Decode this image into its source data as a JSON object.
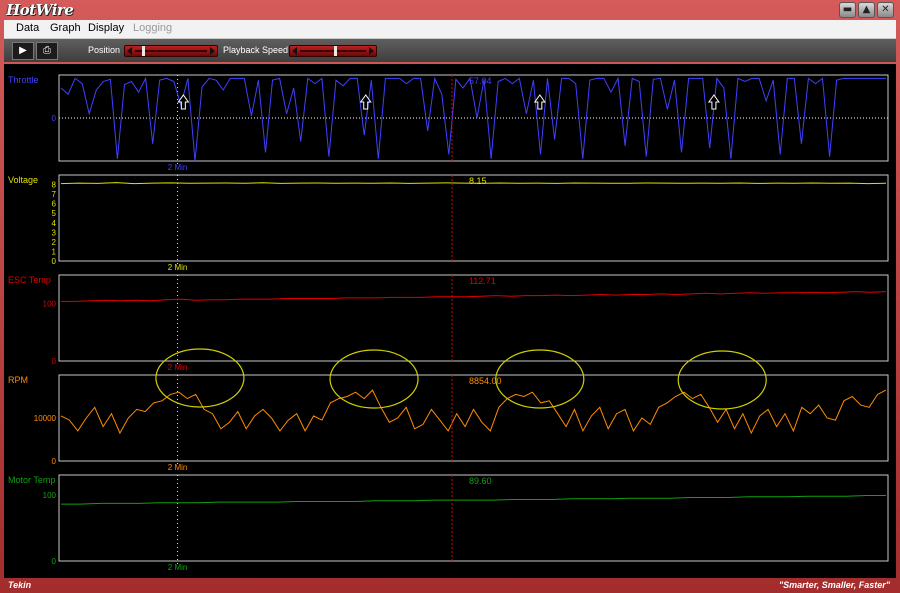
{
  "app": {
    "logo_text": "HotWire",
    "slogan": "\"Smarter, Smaller, Faster\"",
    "status_logo": "Tekin"
  },
  "menu": {
    "items": [
      "Data",
      "Graph",
      "Display",
      "Logging"
    ]
  },
  "toolbar": {
    "position_label": "Position",
    "playback_label": "Playback Speed",
    "position_value": 0.1,
    "playback_value": 0.55
  },
  "colors": {
    "throttle": "#4040ff",
    "voltage": "#e0e000",
    "esc": "#e00000",
    "rpm": "#ff8c00",
    "motor": "#10a010",
    "cursor": "#e00000",
    "highlight": "#d0d000"
  },
  "chart_data": [
    {
      "type": "line",
      "title": "Throttle",
      "cursor_value": "57.04",
      "yticks": [
        "0"
      ],
      "ylim": [
        -100,
        100
      ],
      "marker_label": "2 Min",
      "color": "#4040ff",
      "values": [
        70,
        55,
        92,
        80,
        10,
        65,
        85,
        90,
        -95,
        78,
        85,
        60,
        92,
        -60,
        88,
        92,
        85,
        30,
        92,
        -100,
        72,
        92,
        88,
        65,
        92,
        92,
        92,
        5,
        88,
        -80,
        88,
        92,
        10,
        70,
        -55,
        92,
        80,
        92,
        -90,
        88,
        75,
        92,
        92,
        -40,
        88,
        -95,
        92,
        92,
        92,
        80,
        92,
        92,
        -30,
        92,
        55,
        -85,
        90,
        70,
        92,
        0,
        90,
        -95,
        85,
        92,
        80,
        92,
        10,
        88,
        -85,
        92,
        -50,
        92,
        92,
        80,
        -95,
        88,
        92,
        92,
        60,
        92,
        -65,
        92,
        85,
        -90,
        90,
        92,
        20,
        88,
        -80,
        92,
        92,
        92,
        -70,
        92,
        70,
        -95,
        92,
        85,
        92,
        92,
        40,
        88,
        -85,
        92,
        92,
        -60,
        92,
        80,
        92,
        -90,
        88,
        92,
        92,
        92,
        92,
        92,
        92,
        92
      ]
    },
    {
      "type": "line",
      "title": "Voltage",
      "cursor_value": "8.15",
      "yticks": [
        "0",
        "1",
        "2",
        "3",
        "4",
        "5",
        "6",
        "7",
        "8"
      ],
      "ylim": [
        0,
        9
      ],
      "marker_label": "2 Min",
      "color": "#e0e000",
      "values": [
        8.1,
        8.15,
        8.12,
        8.2,
        8.1,
        8.15,
        8.17,
        8.13,
        8.15,
        8.16,
        8.14,
        8.18,
        8.12,
        8.15,
        8.16,
        8.13,
        8.15,
        8.14,
        8.16,
        8.12,
        8.15,
        8.17,
        8.15,
        8.13,
        8.16,
        8.14,
        8.15,
        8.12,
        8.16,
        8.15,
        8.13,
        8.14,
        8.16,
        8.15,
        8.13,
        8.15,
        8.14,
        8.16,
        8.12,
        8.15,
        8.14,
        8.16,
        8.13,
        8.15,
        8.1,
        8.13
      ]
    },
    {
      "type": "line",
      "title": "ESC Temp",
      "cursor_value": "112.71",
      "yticks": [
        "0",
        "100"
      ],
      "ylim": [
        0,
        150
      ],
      "marker_label": "2 Min",
      "color": "#e00000",
      "values": [
        104,
        104,
        105,
        106,
        105,
        106,
        105,
        107,
        108,
        106,
        107,
        107,
        108,
        108,
        108,
        109,
        109,
        109,
        109,
        110,
        110,
        110,
        111,
        111,
        111,
        112,
        112,
        112,
        113,
        114,
        113,
        114,
        114,
        115,
        114,
        115,
        116,
        115,
        116,
        116,
        117,
        116,
        117,
        118,
        117,
        118,
        119,
        118,
        119,
        119,
        120,
        119,
        120,
        121,
        120,
        121
      ]
    },
    {
      "type": "line",
      "title": "RPM",
      "cursor_value": "8854.00",
      "yticks": [
        "0",
        "10000"
      ],
      "ylim": [
        0,
        20000
      ],
      "marker_label": "2 Min",
      "color": "#ff8c00",
      "values": [
        10500,
        9500,
        7000,
        10000,
        12500,
        8000,
        11000,
        6500,
        10000,
        12000,
        11500,
        13500,
        14000,
        15500,
        16000,
        14500,
        15500,
        12000,
        11000,
        7500,
        9000,
        11500,
        7500,
        10500,
        12000,
        10000,
        7000,
        9500,
        11000,
        7000,
        10500,
        9500,
        13500,
        14500,
        15000,
        16000,
        14500,
        16500,
        12500,
        9000,
        10000,
        12500,
        7500,
        8500,
        12000,
        9500,
        7000,
        11000,
        8000,
        12000,
        9000,
        7000,
        12500,
        14500,
        15500,
        15000,
        16000,
        13500,
        14000,
        11000,
        8000,
        12000,
        7000,
        10500,
        12500,
        7500,
        11000,
        12000,
        7000,
        10000,
        8500,
        12500,
        13500,
        15000,
        16000,
        14500,
        15500,
        12500,
        9000,
        12000,
        7500,
        11000,
        6500,
        10500,
        12000,
        8000,
        11000,
        7000,
        12500,
        11000,
        13000,
        10000,
        9500,
        14000,
        15000,
        13000,
        12500,
        15500,
        16500
      ]
    },
    {
      "type": "line",
      "title": "Motor Temp",
      "cursor_value": "89.60",
      "yticks": [
        "0",
        "100"
      ],
      "ylim": [
        0,
        130
      ],
      "marker_label": "2 Min",
      "color": "#10a010",
      "values": [
        86,
        86,
        87,
        87,
        87,
        88,
        88,
        88,
        89,
        89,
        89,
        89,
        90,
        90,
        90,
        90,
        91,
        91,
        91,
        92,
        92,
        92,
        92,
        93,
        93,
        93,
        94,
        94,
        94,
        95,
        95,
        95,
        96,
        96,
        96,
        97,
        97,
        97,
        98,
        98,
        98,
        99,
        99
      ]
    }
  ]
}
